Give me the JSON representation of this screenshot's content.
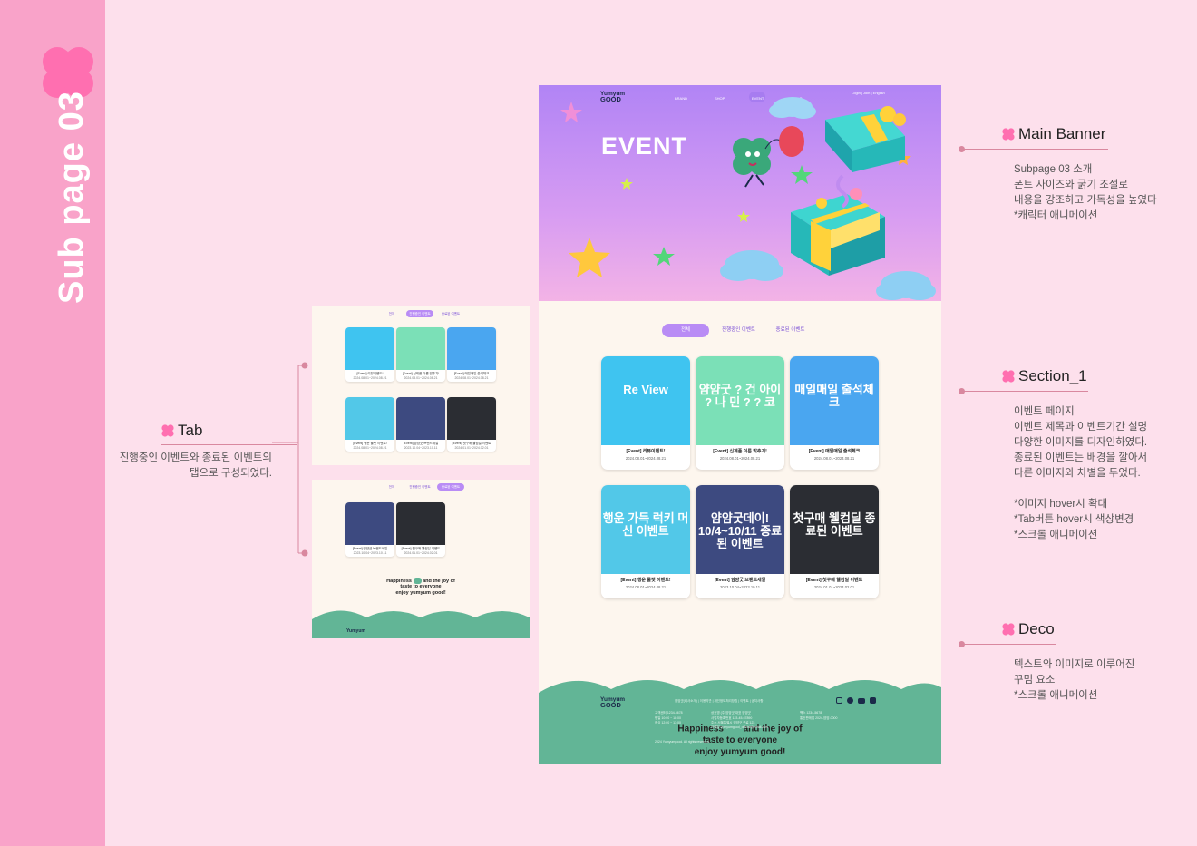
{
  "sidebar": {
    "title": "Sub page 03"
  },
  "annotations": {
    "main_banner": {
      "title": "Main Banner",
      "lines": [
        "Subpage 03 소개",
        "폰트 사이즈와 굵기 조절로",
        "내용을 강조하고 가독성을 높였다",
        "*캐릭터 애니메이션"
      ]
    },
    "section1": {
      "title": "Section_1",
      "lines": [
        "이벤트 페이지",
        "이벤트 제목과 이벤트기간 설명",
        "다양한 이미지를 디자인하였다.",
        "종료된 이벤트는 배경을 깔아서",
        "다른 이미지와 차별을 두었다.",
        "",
        "*이미지 hover시 확대",
        "*Tab버튼 hover시 색상변경",
        "*스크롤 애니메이션"
      ]
    },
    "deco": {
      "title": "Deco",
      "lines": [
        "텍스트와 이미지로 이루어진",
        "꾸밈 요소",
        "*스크롤 애니메이션"
      ]
    },
    "tab": {
      "title": "Tab",
      "lines": [
        "진행중인 이벤트와 종료된 이벤트의",
        "탭으로 구성되었다."
      ]
    }
  },
  "site": {
    "logo_top": "Yumyum",
    "logo_bottom": "GOOD",
    "nav": [
      "BRAND",
      "SHOP",
      "EVENT",
      "HELP"
    ],
    "nav_right": "Login | Join | English",
    "banner_title": "EVENT",
    "tabs": [
      "전체",
      "진행중인 이벤트",
      "종료된 이벤트"
    ],
    "cards": [
      {
        "title": "[Event] 리뷰이벤트!",
        "date": "2024.08.01~2024.08.21",
        "art": "Re View",
        "color": "#3fc4f0"
      },
      {
        "title": "[Event] 신제품 이름 맞추기!",
        "date": "2024.08.01~2024.08.21",
        "art": "얌얌굿 ? 건 아이 ? 나 민 ? ? 코",
        "color": "#7be0b7"
      },
      {
        "title": "[Event] 매일매일 출석체크",
        "date": "2024.08.01~2024.08.21",
        "art": "매일매일 출석체크",
        "color": "#4aa6f0"
      },
      {
        "title": "[Event] 행운 룰렛 이벤트!",
        "date": "2024.08.01~2024.08.21",
        "art": "행운 가득 럭키 머신 이벤트",
        "color": "#52c8e8"
      },
      {
        "title": "[Event] 얌얌굿 브랜드세일",
        "date": "2023.10.04~2023.10.11",
        "art": "얌얌굿데이! 10/4~10/11 종료된 이벤트",
        "color": "#3d4a80"
      },
      {
        "title": "[Event] 첫구매 웰컴딜 이벤트",
        "date": "2024.01.01~2024.02.01",
        "art": "첫구매 웰컴딜 종료된 이벤트",
        "color": "#2b2d33"
      }
    ],
    "tagline": [
      "Happiness",
      "and the joy of",
      "taste to everyone",
      "enjoy yumyum good!"
    ],
    "footer_links": "얌얌굿(회사소개)  |  이용약관  |  개인정보처리방침  |  이벤트  |  공지사항",
    "footer_info": [
      "고객센터   1234-5678",
      "평일 10:00 ~ 18:00",
      "점심 12:00 ~ 13:00",
      "상호명 (주)얌얌굿  대표 얌얌굿",
      "사업자등록번호 123-45-67890",
      "주소 서울특별시 얌얌구 굿로 123",
      "이메일 yumyumgood_official@email.com",
      "팩스 1234-5678",
      "통신판매업 2024-얌얌-0000"
    ],
    "copyright": "2024 Yumyumgood. All rights reserved."
  },
  "mini": {
    "tabs": [
      "전체",
      "진행중인 이벤트",
      "종료된 이벤트"
    ],
    "cards_a": [
      {
        "title": "[Event] 리뷰이벤트!",
        "date": "2024.08.01~2024.08.21"
      },
      {
        "title": "[Event] 신제품 이름 맞추기!",
        "date": "2024.08.01~2024.08.21"
      },
      {
        "title": "[Event] 매일매일 출석체크",
        "date": "2024.08.01~2024.08.21"
      },
      {
        "title": "[Event] 행운 룰렛 이벤트!",
        "date": "2024.08.01~2024.08.21"
      },
      {
        "title": "[Event] 얌얌굿 브랜드세일",
        "date": "2023.10.04~2023.10.11"
      },
      {
        "title": "[Event] 첫구매 웰컴딜 이벤트",
        "date": "2024.01.01~2024.02.01"
      }
    ],
    "cards_b": [
      {
        "title": "[Event] 얌얌굿 브랜드세일",
        "date": "2023.10.04~2023.10.11"
      },
      {
        "title": "[Event] 첫구매 웰컴딜 이벤트",
        "date": "2024.01.01~2024.02.01"
      }
    ],
    "tagline": [
      "Happiness",
      "and the joy of",
      "taste to everyone",
      "enjoy yumyum good!"
    ]
  },
  "colors": {
    "pink_bg": "#fde0ec",
    "sidebar": "#f9a3c9",
    "accent": "#b98cf5",
    "footer": "#62b596",
    "flower": "#ff6fb0"
  }
}
